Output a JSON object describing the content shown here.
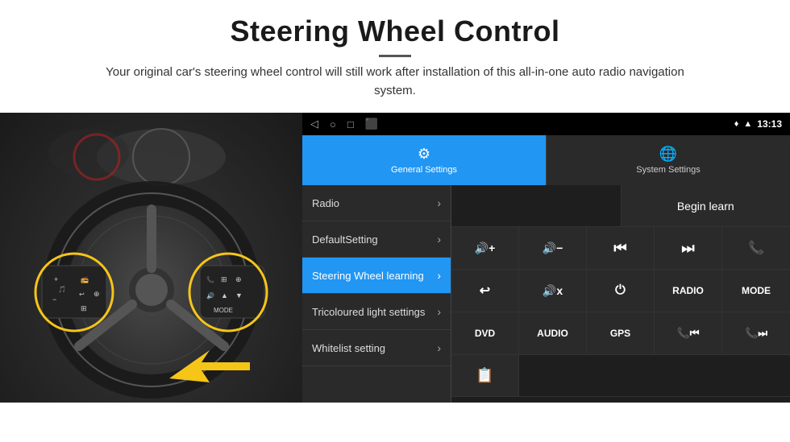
{
  "header": {
    "title": "Steering Wheel Control",
    "subtitle": "Your original car's steering wheel control will still work after installation of this all-in-one auto radio navigation system."
  },
  "status_bar": {
    "nav_icons": [
      "◁",
      "○",
      "□",
      "⬛"
    ],
    "right_icons": "♦ ▲",
    "time": "13:13"
  },
  "tabs": [
    {
      "id": "general",
      "label": "General Settings",
      "icon": "⚙",
      "active": true
    },
    {
      "id": "system",
      "label": "System Settings",
      "icon": "🌐",
      "active": false
    }
  ],
  "menu_items": [
    {
      "label": "Radio",
      "active": false
    },
    {
      "label": "DefaultSetting",
      "active": false
    },
    {
      "label": "Steering Wheel learning",
      "active": true
    },
    {
      "label": "Tricoloured light settings",
      "active": false
    },
    {
      "label": "Whitelist setting",
      "active": false
    }
  ],
  "controls": {
    "begin_learn_label": "Begin learn",
    "row1": [
      "🔊+",
      "🔊−",
      "⏮",
      "⏭",
      "📞"
    ],
    "row2": [
      "↩",
      "🔊x",
      "⏻",
      "RADIO",
      "MODE"
    ],
    "row3": [
      "DVD",
      "AUDIO",
      "GPS",
      "📞⏮",
      "📞⏭"
    ],
    "row4_icon": "📋"
  }
}
